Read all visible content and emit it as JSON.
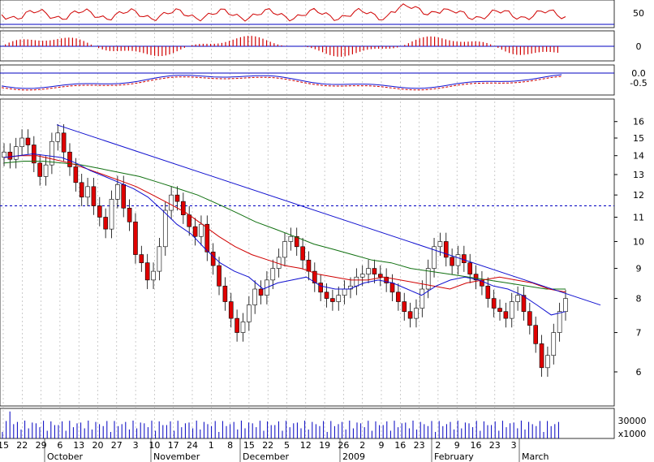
{
  "chart_data": {
    "type": "candlestick",
    "colors": {
      "up_fill": "#ffffff",
      "down_fill": "#e00000",
      "doji_fill": "#000000",
      "ma_fast": "#1010d0",
      "ma_mid": "#d00000",
      "ma_slow": "#107010",
      "trendline": "#1010d0",
      "macd_hist": "#d00000",
      "rsi_line": "#d00000",
      "ref_line": "#0000c0",
      "grid": "#aaaaaa",
      "volume": "#0000c0"
    },
    "price_axis": {
      "scale": "log",
      "ticks": [
        "16",
        "15",
        "14",
        "13",
        "12",
        "11",
        "10",
        "9",
        "8",
        "7",
        "6"
      ],
      "min": 5.3,
      "max": 17.2
    },
    "rsi_panel": {
      "ticks": [
        "50",
        "0"
      ],
      "ref_level": 35
    },
    "macd_panel": {
      "ticks": [
        "0"
      ]
    },
    "osc_panel": {
      "ticks": [
        "0.0",
        "-0.5"
      ]
    },
    "volume_panel": {
      "ticks": [
        "30000",
        "x1000"
      ]
    },
    "x_axis": {
      "day_labels": [
        "15",
        "22",
        "29",
        "6",
        "13",
        "20",
        "27",
        "3",
        "10",
        "17",
        "24",
        "1",
        "8",
        "15",
        "22",
        "5",
        "12",
        "19",
        "26",
        "2",
        "9",
        "16",
        "23",
        "2",
        "9",
        "16",
        "23",
        "3"
      ],
      "month_labels": [
        "October",
        "November",
        "December",
        "2009",
        "February",
        "March"
      ]
    },
    "horizontal_level": 11.5,
    "trendline": {
      "from": 15.8,
      "to": 8.1
    },
    "closes": [
      14.2,
      13.8,
      14.5,
      15.0,
      14.6,
      13.6,
      12.9,
      13.5,
      14.8,
      15.3,
      14.2,
      13.4,
      12.6,
      11.9,
      12.4,
      11.5,
      11.0,
      10.5,
      11.8,
      12.5,
      11.4,
      10.8,
      9.5,
      9.2,
      8.6,
      8.9,
      9.8,
      11.3,
      12.0,
      11.7,
      11.1,
      10.6,
      10.2,
      10.7,
      9.6,
      9.1,
      8.4,
      7.9,
      7.4,
      7.0,
      7.3,
      7.8,
      8.3,
      8.1,
      8.6,
      9.0,
      9.4,
      10.0,
      10.2,
      9.8,
      9.3,
      8.9,
      8.5,
      8.2,
      8.0,
      7.9,
      8.1,
      8.3,
      8.4,
      8.7,
      8.8,
      9.0,
      8.8,
      8.7,
      8.5,
      8.2,
      7.9,
      7.6,
      7.4,
      7.7,
      8.3,
      9.0,
      9.8,
      10.0,
      9.4,
      9.1,
      9.5,
      9.2,
      8.8,
      8.6,
      8.4,
      8.0,
      7.7,
      7.6,
      7.4,
      7.9,
      8.1,
      7.6,
      7.2,
      6.7,
      6.1,
      6.4,
      7.0,
      7.6,
      8.0
    ],
    "ma_fast": [
      13.9,
      14.0,
      14.1,
      14.0,
      13.9,
      13.6,
      13.2,
      12.9,
      12.6,
      12.3,
      11.9,
      11.3,
      10.7,
      10.3,
      9.7,
      9.2,
      8.9,
      8.7,
      8.3,
      8.5,
      8.6,
      8.7,
      8.4,
      8.3,
      8.3,
      8.5,
      8.6,
      8.5,
      8.3,
      8.1,
      8.4,
      8.6,
      8.7,
      8.6,
      8.4,
      8.3,
      8.1,
      7.8,
      7.5,
      7.6
    ],
    "ma_mid": [
      13.9,
      14.0,
      14.0,
      13.8,
      13.6,
      13.3,
      13.0,
      12.7,
      12.4,
      12.0,
      11.6,
      11.2,
      10.7,
      10.2,
      9.8,
      9.5,
      9.3,
      9.1,
      9.0,
      8.8,
      8.7,
      8.6,
      8.6,
      8.7,
      8.6,
      8.5,
      8.4,
      8.3,
      8.5,
      8.6,
      8.7,
      8.6,
      8.5,
      8.3,
      8.2
    ],
    "ma_slow": [
      13.6,
      13.7,
      13.7,
      13.6,
      13.5,
      13.3,
      13.1,
      12.9,
      12.6,
      12.3,
      12.0,
      11.6,
      11.2,
      10.8,
      10.5,
      10.2,
      9.9,
      9.7,
      9.5,
      9.3,
      9.2,
      9.0,
      8.9,
      8.8,
      8.7,
      8.6,
      8.5,
      8.4,
      8.3,
      8.3
    ]
  }
}
